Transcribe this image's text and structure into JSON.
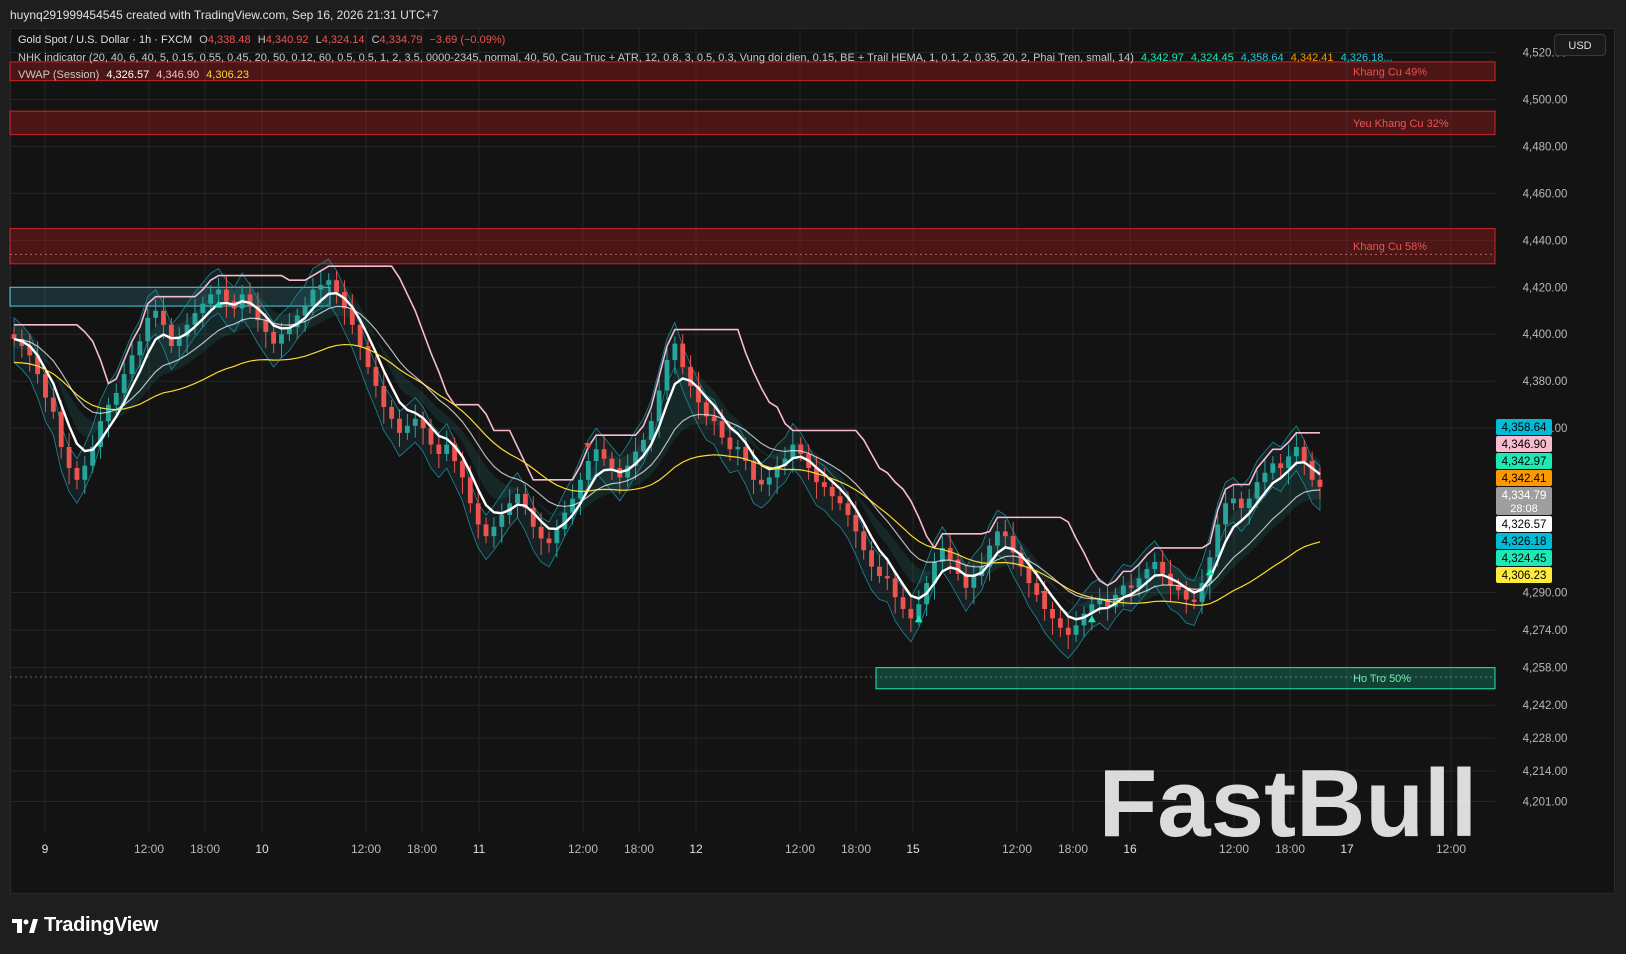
{
  "header": {
    "caption": "huynq291999454545 created with TradingView.com, Sep 16, 2026 21:31 UTC+7"
  },
  "legend": {
    "symbol": "Gold Spot / U.S. Dollar · 1h · FXCM",
    "o_label": "O",
    "o": "4,338.48",
    "h_label": "H",
    "h": "4,340.92",
    "l_label": "L",
    "l": "4,324.14",
    "c_label": "C",
    "c": "4,334.79",
    "change": "−3.69 (−0.09%)",
    "indicator_name": "NHK indicator (20, 40, 6, 40, 5, 0.15, 0.55, 0.45, 20, 50, 0.12, 60, 0.5, 0.5, 1, 2, 3.5, 0000-2345, normal, 40, 50, Cau Truc + ATR, 12, 0.8, 3, 0.5, 0.3, Vung doi dien, 0.15, BE + Trail HEMA, 1, 0.1, 2, 0.35, 20, 2, Phai Tren, small, 14)",
    "indicator_values": [
      "4,342.97",
      "4,324.45",
      "4,358.64",
      "4,342.41",
      "4,326.18..."
    ],
    "vwap_name": "VWAP (Session)",
    "vwap_values": [
      "4,326.57",
      "4,346.90",
      "4,306.23"
    ]
  },
  "currency_button": "USD",
  "footer": {
    "logo_text": "TradingView"
  },
  "watermark": "FastBull",
  "colors": {
    "up": "#26a69a",
    "down": "#ef5350",
    "zone_red": "#b71c1c",
    "zone_green": "#1de9b6",
    "band_pink": "#f8bbd0",
    "hema_white": "#ffffff",
    "vwap_yellow": "#fdd835",
    "aqua": "#4dd0e1"
  },
  "chart_data": {
    "type": "candlestick",
    "title": "Gold Spot / U.S. Dollar · 1h · FXCM",
    "ylim": [
      4188,
      4530
    ],
    "y_ticks": [
      "4,520.00",
      "4,500.00",
      "4,480.00",
      "4,460.00",
      "4,440.00",
      "4,420.00",
      "4,400.00",
      "4,380.00",
      "4,360.00",
      "4,290.00",
      "4,274.00",
      "4,258.00",
      "4,242.00",
      "4,228.00",
      "4,214.00",
      "4,201.00"
    ],
    "x_ticks": [
      "9",
      "12:00",
      "18:00",
      "10",
      "12:00",
      "18:00",
      "11",
      "12:00",
      "18:00",
      "12",
      "12:00",
      "18:00",
      "15",
      "12:00",
      "18:00",
      "16",
      "12:00",
      "18:00",
      "17",
      "12:00"
    ],
    "zones": [
      {
        "label": "Khang Cu 49%",
        "kind": "resistance",
        "y_top": 4516,
        "y_bottom": 4508
      },
      {
        "label": "Yeu Khang Cu 32%",
        "kind": "resistance",
        "y_top": 4495,
        "y_bottom": 4485
      },
      {
        "label": "Khang Cu 58%",
        "kind": "resistance",
        "y_top": 4445,
        "y_bottom": 4430
      },
      {
        "label": "Ho Tro 50%",
        "kind": "support",
        "y_top": 4258,
        "y_bottom": 4249
      }
    ],
    "price_labels": [
      {
        "value": "4,358.64",
        "bg": "#00bcd4",
        "fg": "#000000"
      },
      {
        "value": "4,346.90",
        "bg": "#f8bbd0",
        "fg": "#000000"
      },
      {
        "value": "4,342.97",
        "bg": "#1de9b6",
        "fg": "#000000"
      },
      {
        "value": "4,342.41",
        "bg": "#ff9800",
        "fg": "#000000"
      },
      {
        "value": "4,334.79",
        "sub": "28:08",
        "bg": "#9e9e9e",
        "fg": "#ffffff"
      },
      {
        "value": "4,326.57",
        "bg": "#ffffff",
        "fg": "#000000"
      },
      {
        "value": "4,326.18",
        "bg": "#00bcd4",
        "fg": "#000000"
      },
      {
        "value": "4,324.45",
        "bg": "#1de9b6",
        "fg": "#000000"
      },
      {
        "value": "4,306.23",
        "bg": "#ffeb3b",
        "fg": "#000000"
      }
    ],
    "closes": [
      4398,
      4395,
      4391,
      4383,
      4373,
      4367,
      4352,
      4343,
      4338,
      4344,
      4352,
      4363,
      4370,
      4375,
      4383,
      4391,
      4397,
      4407,
      4410,
      4404,
      4395,
      4399,
      4404,
      4409,
      4413,
      4417,
      4419,
      4414,
      4411,
      4417,
      4412,
      4406,
      4401,
      4396,
      4400,
      4403,
      4408,
      4412,
      4419,
      4421,
      4423,
      4418,
      4411,
      4404,
      4395,
      4386,
      4378,
      4369,
      4364,
      4358,
      4361,
      4364,
      4360,
      4353,
      4349,
      4353,
      4346,
      4339,
      4328,
      4319,
      4314,
      4318,
      4323,
      4328,
      4332,
      4326,
      4318,
      4313,
      4311,
      4317,
      4324,
      4330,
      4338,
      4346,
      4351,
      4347,
      4343,
      4339,
      4344,
      4350,
      4355,
      4363,
      4376,
      4389,
      4396,
      4386,
      4378,
      4371,
      4365,
      4363,
      4356,
      4351,
      4352,
      4346,
      4338,
      4336,
      4339,
      4344,
      4347,
      4353,
      4349,
      4343,
      4337,
      4335,
      4331,
      4328,
      4323,
      4316,
      4308,
      4301,
      4297,
      4296,
      4288,
      4283,
      4279,
      4285,
      4294,
      4303,
      4309,
      4304,
      4298,
      4292,
      4297,
      4301,
      4310,
      4316,
      4314,
      4307,
      4301,
      4294,
      4289,
      4283,
      4279,
      4275,
      4272,
      4276,
      4281,
      4285,
      4287,
      4284,
      4289,
      4293,
      4292,
      4296,
      4300,
      4303,
      4298,
      4293,
      4291,
      4287,
      4286,
      4294,
      4305,
      4319,
      4328,
      4330,
      4326,
      4330,
      4337,
      4341,
      4345,
      4343,
      4348,
      4352,
      4346,
      4338,
      4335
    ]
  }
}
